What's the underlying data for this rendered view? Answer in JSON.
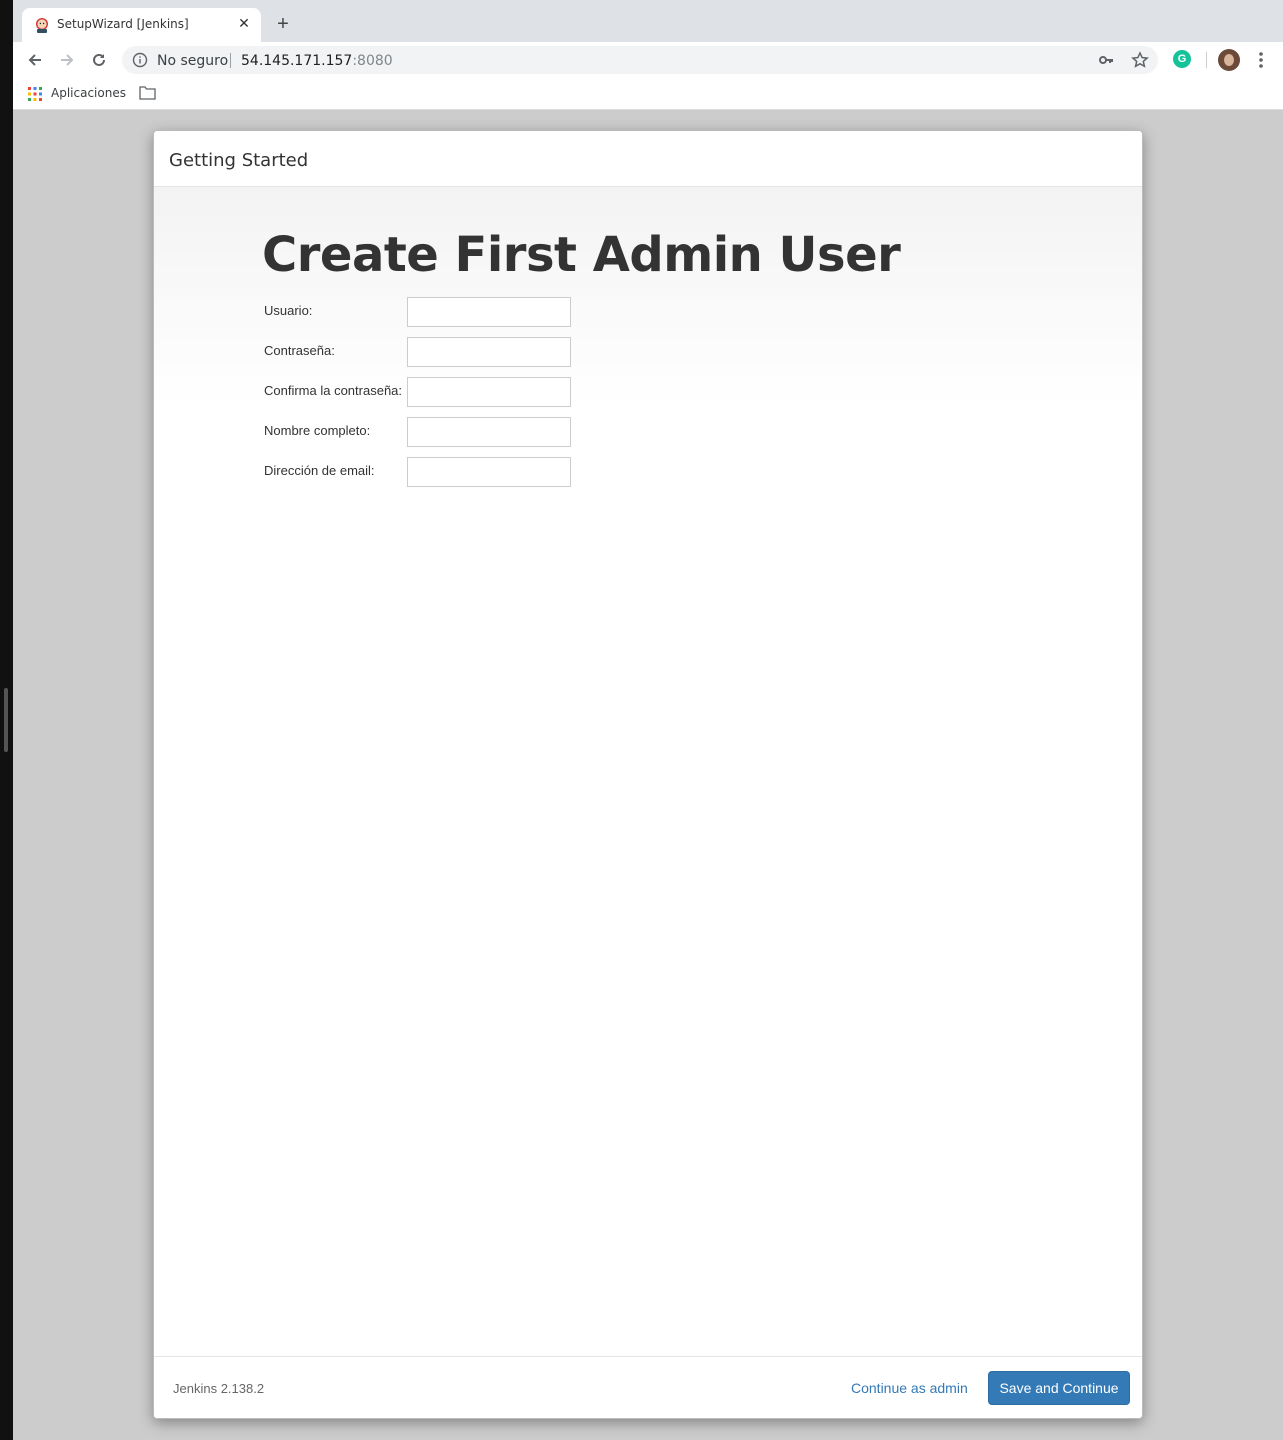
{
  "browser": {
    "tab_title": "SetupWizard [Jenkins]",
    "tab_close": "✕",
    "new_tab": "+",
    "security_label": "No seguro",
    "url_host": "54.145.171.157",
    "url_port": ":8080",
    "bookmarks": {
      "apps_label": "Aplicaciones"
    },
    "extension_letter": "G"
  },
  "dialog": {
    "header_title": "Getting Started",
    "page_title": "Create First Admin User",
    "fields": [
      {
        "label": "Usuario:",
        "value": ""
      },
      {
        "label": "Contraseña:",
        "value": ""
      },
      {
        "label": "Confirma la contraseña:",
        "value": ""
      },
      {
        "label": "Nombre completo:",
        "value": ""
      },
      {
        "label": "Dirección de email:",
        "value": ""
      }
    ],
    "footer": {
      "version": "Jenkins 2.138.2",
      "continue_as_admin": "Continue as admin",
      "save_and_continue": "Save and Continue"
    }
  },
  "colors": {
    "primary": "#337ab7",
    "background": "#cccccc",
    "grammarly": "#15c39a"
  },
  "icons": [
    "jenkins-favicon-icon",
    "back-arrow-icon",
    "forward-arrow-icon",
    "reload-icon",
    "info-icon",
    "key-icon",
    "star-icon",
    "grammarly-icon",
    "avatar",
    "menu-dots-icon",
    "apps-grid-icon",
    "folder-icon"
  ]
}
